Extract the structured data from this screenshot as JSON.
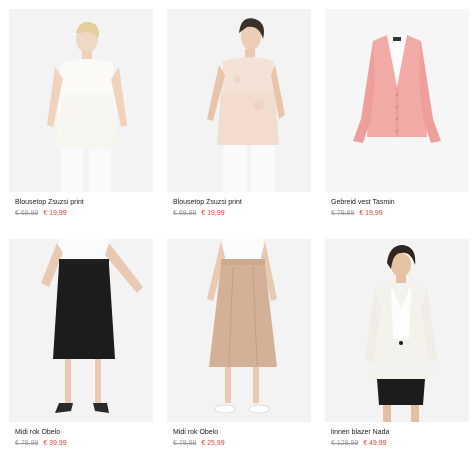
{
  "products": [
    {
      "name": "Blousetop Zsuzsi print",
      "old_price": "€ 69,99",
      "new_price": "€ 19,99",
      "image": "model-white-top"
    },
    {
      "name": "Blousetop Zsuzsi print",
      "old_price": "€ 69,99",
      "new_price": "€ 19,99",
      "image": "model-print-top"
    },
    {
      "name": "Gebreid vest Tasmin",
      "old_price": "€ 79,99",
      "new_price": "€ 19,99",
      "image": "pink-cardigan"
    },
    {
      "name": "Midi rok Obelo",
      "old_price": "€ 79,99",
      "new_price": "€ 39,99",
      "image": "black-midi-skirt"
    },
    {
      "name": "Midi rok Obelo",
      "old_price": "€ 79,99",
      "new_price": "€ 25,99",
      "image": "beige-midi-skirt"
    },
    {
      "name": "linnen blazer Nada",
      "old_price": "€ 129,99",
      "new_price": "€ 49,99",
      "image": "white-linen-blazer"
    }
  ],
  "colors": {
    "sale": "#e0443a",
    "strike": "#9a9a9a",
    "tile_bg": "#f3f3f3"
  }
}
